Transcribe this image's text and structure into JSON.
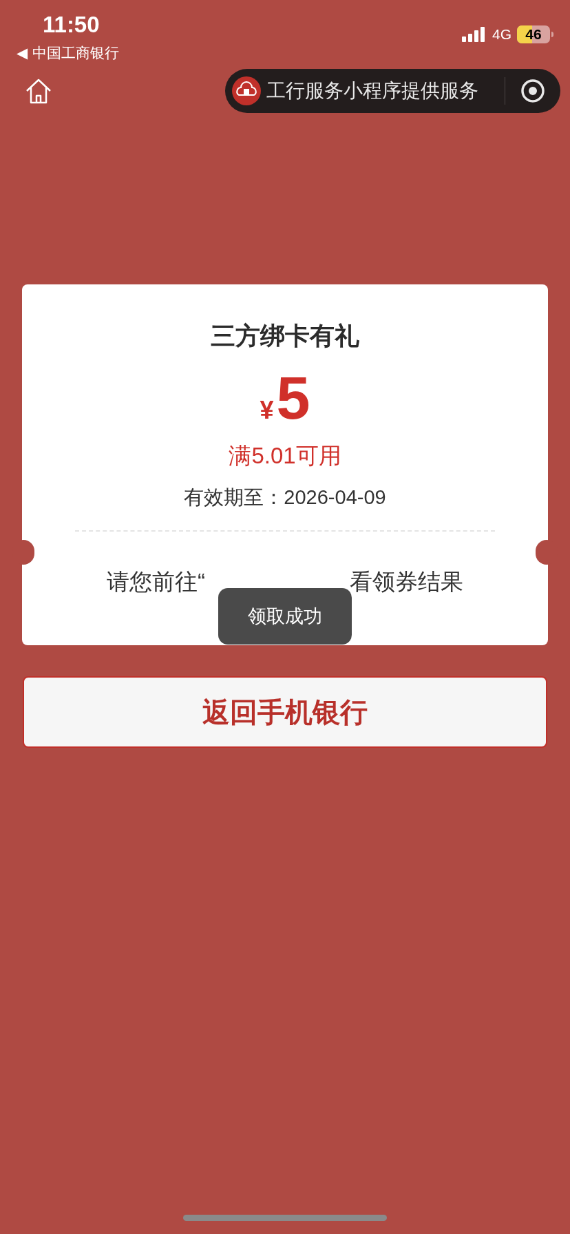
{
  "status_bar": {
    "time": "11:50",
    "back_app": "◀ 中国工商银行",
    "network": "4G",
    "battery": "46"
  },
  "nav": {
    "capsule_text": "工行服务小程序提供服务"
  },
  "coupon": {
    "title": "三方绑卡有礼",
    "currency": "¥",
    "amount": "5",
    "condition": "满5.01可用",
    "validity": "有效期至：2026-04-09",
    "hint_before": "请您前往“",
    "hint_after": "看领券结果"
  },
  "toast": "领取成功",
  "return_button": "返回手机银行"
}
